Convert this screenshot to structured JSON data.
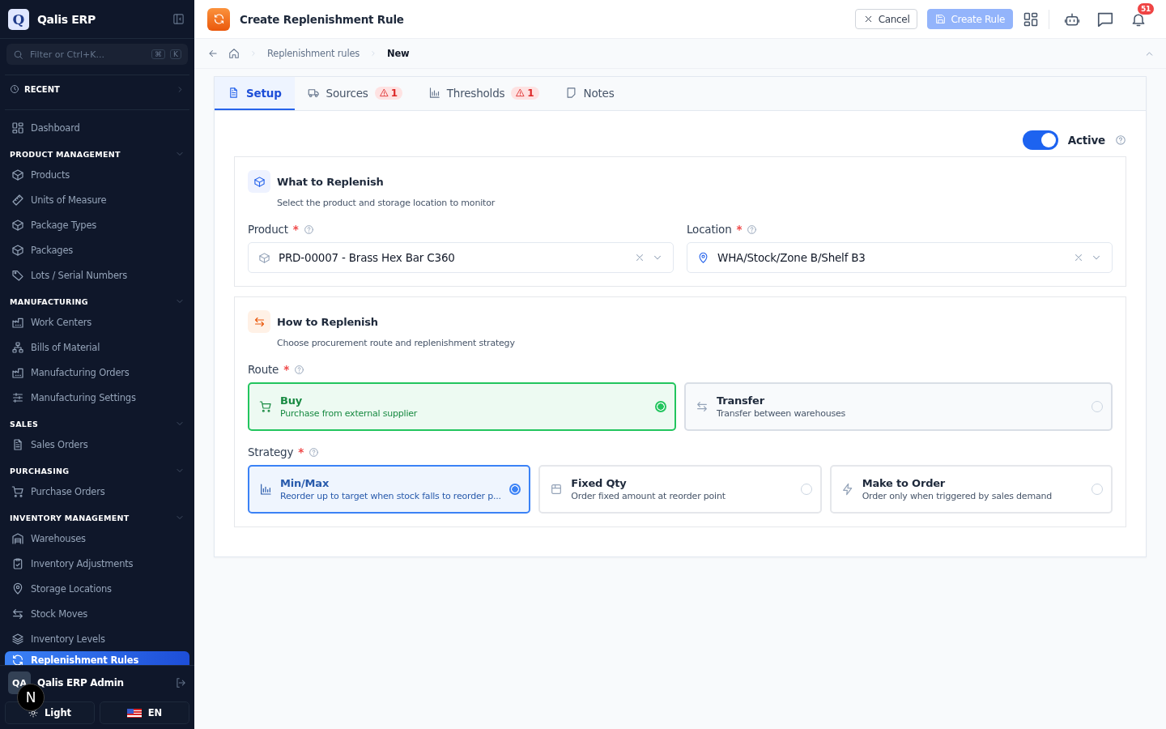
{
  "app": {
    "name": "Qalis ERP",
    "logo_letter": "Q",
    "search_placeholder": "Filter or Ctrl+K...",
    "shortcut_keys": [
      "⌘",
      "K"
    ]
  },
  "recent": {
    "label": "RECENT"
  },
  "sidebar": {
    "items": [
      {
        "label": "Dashboard",
        "selected": false
      }
    ],
    "groups": [
      {
        "title": "PRODUCT MANAGEMENT",
        "expanded": true,
        "items": [
          {
            "label": "Products",
            "selected": false
          },
          {
            "label": "Units of Measure",
            "selected": false
          },
          {
            "label": "Package Types",
            "selected": false
          },
          {
            "label": "Packages",
            "selected": false
          },
          {
            "label": "Lots / Serial Numbers",
            "selected": false
          }
        ]
      },
      {
        "title": "MANUFACTURING",
        "expanded": true,
        "items": [
          {
            "label": "Work Centers",
            "selected": false
          },
          {
            "label": "Bills of Material",
            "selected": false
          },
          {
            "label": "Manufacturing Orders",
            "selected": false
          },
          {
            "label": "Manufacturing Settings",
            "selected": false
          }
        ]
      },
      {
        "title": "SALES",
        "expanded": true,
        "items": [
          {
            "label": "Sales Orders",
            "selected": false
          }
        ]
      },
      {
        "title": "PURCHASING",
        "expanded": true,
        "items": [
          {
            "label": "Purchase Orders",
            "selected": false
          }
        ]
      },
      {
        "title": "INVENTORY MANAGEMENT",
        "expanded": true,
        "items": [
          {
            "label": "Warehouses",
            "selected": false
          },
          {
            "label": "Inventory Adjustments",
            "selected": false
          },
          {
            "label": "Storage Locations",
            "selected": false
          },
          {
            "label": "Stock Moves",
            "selected": false
          },
          {
            "label": "Inventory Levels",
            "selected": false
          },
          {
            "label": "Replenishment Rules",
            "selected": true
          }
        ]
      }
    ]
  },
  "user": {
    "initials": "QA",
    "name": "Qalis ERP Admin"
  },
  "theme_button": "Light",
  "language_button": "EN",
  "dev_badge": "N",
  "header": {
    "title": "Create Replenishment Rule",
    "cancel": "Cancel",
    "create": {
      "label": "Create Rule",
      "disabled": true
    },
    "notifications": "51"
  },
  "breadcrumb": [
    "Replenishment rules",
    "New"
  ],
  "tabs": [
    {
      "label": "Setup",
      "selected": true
    },
    {
      "label": "Sources",
      "selected": false,
      "warning": "1"
    },
    {
      "label": "Thresholds",
      "selected": false,
      "warning": "1"
    },
    {
      "label": "Notes",
      "selected": false
    }
  ],
  "active_toggle": {
    "label": "Active",
    "on": true
  },
  "sections": [
    {
      "title": "What to Replenish",
      "subtitle": "Select the product and storage location to monitor",
      "fields": [
        {
          "label": "Product",
          "required": "*",
          "value": "PRD-00007 - Brass Hex Bar C360"
        },
        {
          "label": "Location",
          "required": "*",
          "value": "WHA/Stock/Zone B/Shelf B3"
        }
      ]
    },
    {
      "title": "How to Replenish",
      "subtitle": "Choose procurement route and replenishment strategy",
      "choices": [
        {
          "label": "Route",
          "required": "*",
          "color": "#22c55e",
          "options": [
            {
              "title": "Buy",
              "description": "Purchase from external supplier",
              "selected": true
            },
            {
              "title": "Transfer",
              "description": "Transfer between warehouses",
              "selected": false
            }
          ]
        },
        {
          "label": "Strategy",
          "required": "*",
          "color": "#3b82f6",
          "options": [
            {
              "title": "Min/Max",
              "description": "Reorder up to target when stock falls to reorder p...",
              "selected": true
            },
            {
              "title": "Fixed Qty",
              "description": "Order fixed amount at reorder point",
              "selected": false
            },
            {
              "title": "Make to Order",
              "description": "Order only when triggered by sales demand",
              "selected": false
            }
          ]
        }
      ]
    }
  ]
}
